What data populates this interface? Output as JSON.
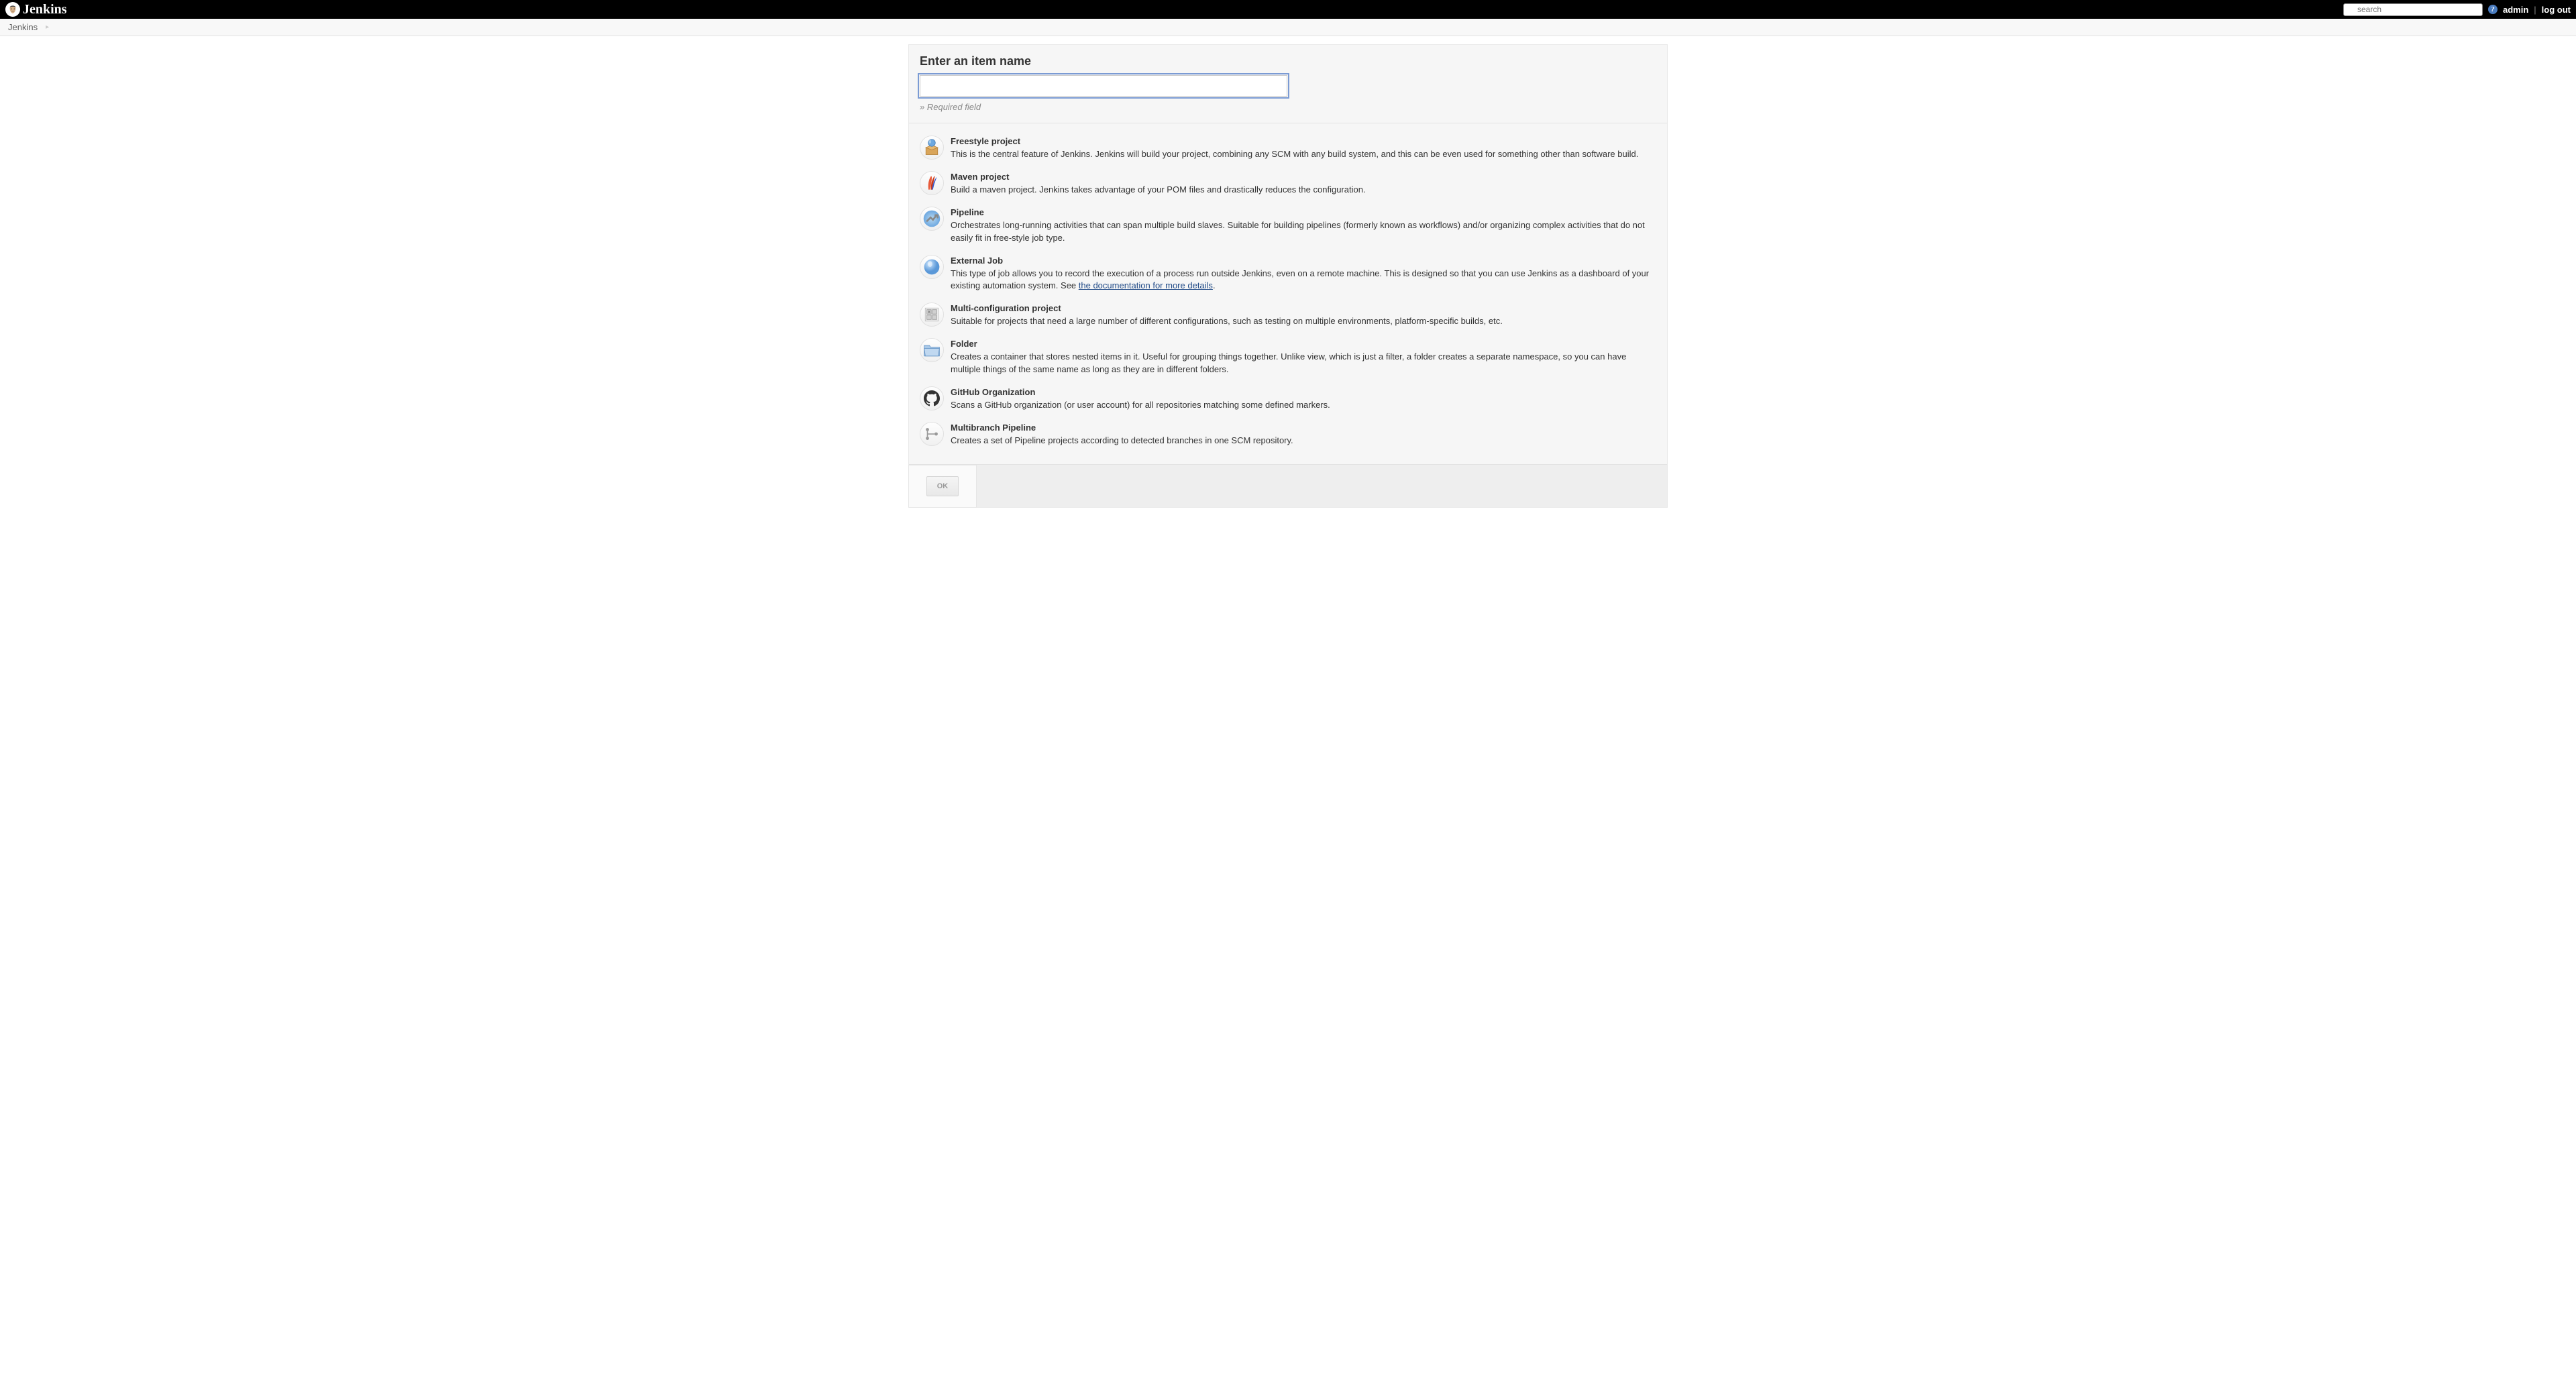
{
  "header": {
    "logo_text": "Jenkins",
    "search_placeholder": "search",
    "user_link": "admin",
    "logout_link": "log out"
  },
  "breadcrumb": {
    "items": [
      "Jenkins"
    ]
  },
  "form": {
    "heading": "Enter an item name",
    "input_value": "",
    "required_hint": "» Required field"
  },
  "item_types": [
    {
      "title": "Freestyle project",
      "desc": "This is the central feature of Jenkins. Jenkins will build your project, combining any SCM with any build system, and this can be even used for something other than software build.",
      "icon": "freestyle"
    },
    {
      "title": "Maven project",
      "desc": "Build a maven project. Jenkins takes advantage of your POM files and drastically reduces the configuration.",
      "icon": "maven"
    },
    {
      "title": "Pipeline",
      "desc": "Orchestrates long-running activities that can span multiple build slaves. Suitable for building pipelines (formerly known as workflows) and/or organizing complex activities that do not easily fit in free-style job type.",
      "icon": "pipeline"
    },
    {
      "title": "External Job",
      "desc_prefix": "This type of job allows you to record the execution of a process run outside Jenkins, even on a remote machine. This is designed so that you can use Jenkins as a dashboard of your existing automation system. See ",
      "link_text": "the documentation for more details",
      "desc_suffix": ".",
      "icon": "external"
    },
    {
      "title": "Multi-configuration project",
      "desc": "Suitable for projects that need a large number of different configurations, such as testing on multiple environments, platform-specific builds, etc.",
      "icon": "multiconfig"
    },
    {
      "title": "Folder",
      "desc": "Creates a container that stores nested items in it. Useful for grouping things together. Unlike view, which is just a filter, a folder creates a separate namespace, so you can have multiple things of the same name as long as they are in different folders.",
      "icon": "folder"
    },
    {
      "title": "GitHub Organization",
      "desc": "Scans a GitHub organization (or user account) for all repositories matching some defined markers.",
      "icon": "github"
    },
    {
      "title": "Multibranch Pipeline",
      "desc": "Creates a set of Pipeline projects according to detected branches in one SCM repository.",
      "icon": "multibranch"
    }
  ],
  "ok_button": "OK"
}
